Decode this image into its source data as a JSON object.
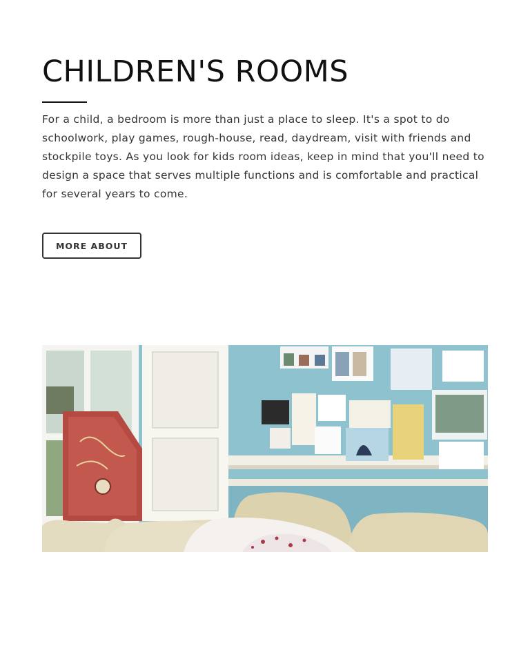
{
  "section": {
    "title": "CHILDREN'S ROOMS",
    "intro": "For a child, a bedroom is more than just a place to sleep. It's a spot to do schoolwork, play games, rough-house, read, daydream, visit with friends and stockpile toys. As you look for kids room ideas, keep in mind that you'll need to design a space that serves multiple functions and is comfortable and practical for several years to come.",
    "button_label": "MORE ABOUT"
  },
  "photo": {
    "subject": "kids-bedroom-photo"
  },
  "colors": {
    "wall": "#8fc2cf",
    "text": "#333333",
    "border": "#333333"
  }
}
